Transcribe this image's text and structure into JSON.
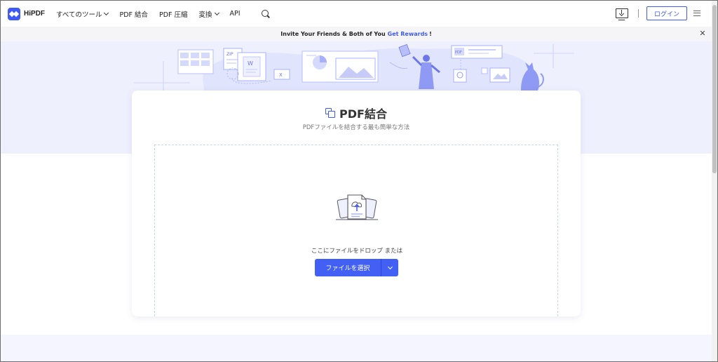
{
  "header": {
    "logo_text": "HiPDF",
    "nav": [
      {
        "label": "すべてのツール",
        "has_dropdown": true
      },
      {
        "label": "PDF 結合",
        "has_dropdown": false
      },
      {
        "label": "PDF 圧縮",
        "has_dropdown": false
      },
      {
        "label": "変換",
        "has_dropdown": true
      },
      {
        "label": "API",
        "has_dropdown": false
      }
    ],
    "login_label": "ログイン"
  },
  "promo": {
    "text": "Invite Your Friends & Both of You",
    "highlight": "Get Rewards",
    "suffix": "!",
    "close": "✕"
  },
  "illustration": {
    "zip_label": "ZIP",
    "word_label": "W",
    "excel_label": "X",
    "pdf_label": "PDF"
  },
  "tool": {
    "title": "PDF結合",
    "subtitle": "PDFファイルを結合する最も簡単な方法",
    "drop_text": "ここにファイルをドロップ または",
    "choose_label": "ファイルを選択"
  },
  "colors": {
    "accent": "#4360f5",
    "hero_bg": "#eff0fe",
    "illustration": "#a7b0f8"
  }
}
